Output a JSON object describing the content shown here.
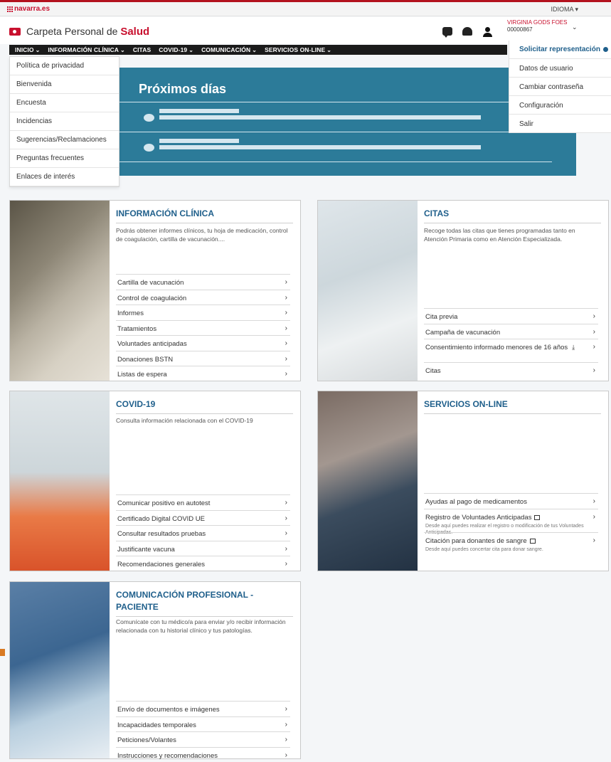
{
  "topbar": {
    "site": "navarra.es",
    "language": "IDIOMA"
  },
  "header": {
    "app_prefix": "Carpeta Personal de",
    "app_highlight": "Salud",
    "user_name": "VIRGINIA GODS FOES",
    "user_id": "00000867",
    "icons": [
      "chat-icon",
      "notification-icon",
      "user-icon"
    ]
  },
  "nav": {
    "items": [
      {
        "label": "INICIO"
      },
      {
        "label": "INFORMACIÓN CLÍNICA"
      },
      {
        "label": "CITAS"
      },
      {
        "label": "COVID-19"
      },
      {
        "label": "COMUNICACIÓN"
      },
      {
        "label": "SERVICIOS ON-LINE"
      }
    ]
  },
  "inicio_menu": [
    "Política de privacidad",
    "Bienvenida",
    "Encuesta",
    "Incidencias",
    "Sugerencias/Reclamaciones",
    "Preguntas frecuentes",
    "Enlaces de interés"
  ],
  "user_menu": {
    "solicitar": "Solicitar representación",
    "items": [
      "Datos de usuario",
      "Cambiar contraseña",
      "Configuración",
      "Salir"
    ]
  },
  "proximos": {
    "title": "Próximos días"
  },
  "cards": {
    "clinica": {
      "title": "INFORMACIÓN CLÍNICA",
      "desc": "Podrás obtener informes clínicos, tu hoja de medicación, control de coagulación, cartilla de vacunación....",
      "links": [
        "Cartilla de vacunación",
        "Control de coagulación",
        "Informes",
        "Tratamientos",
        "Voluntades anticipadas",
        "Donaciones BSTN",
        "Listas de espera"
      ]
    },
    "citas": {
      "title": "CITAS",
      "desc": "Recoge todas las citas que tienes programadas tanto en Atención Primaria como en Atención Especializada.",
      "links": [
        "Cita previa",
        "Campaña de vacunación",
        "Consentimiento informado menores de 16 años",
        "Citas"
      ]
    },
    "covid": {
      "title": "COVID-19",
      "desc": "Consulta información relacionada con el COVID-19",
      "links": [
        "Comunicar positivo en autotest",
        "Certificado Digital COVID UE",
        "Consultar resultados pruebas",
        "Justificante vacuna",
        "Recomendaciones generales"
      ]
    },
    "servicios": {
      "title": "SERVICIOS ON-LINE",
      "links": [
        {
          "label": "Ayudas al pago de medicamentos",
          "sub": ""
        },
        {
          "label": "Registro de Voluntades Anticipadas",
          "sub": "Desde aquí puedes realizar el registro o modificación de tus Voluntades Anticipadas."
        },
        {
          "label": "Citación para donantes de sangre",
          "sub": "Desde aquí puedes concertar cita para donar sangre."
        }
      ]
    },
    "comunicacion": {
      "title": "COMUNICACIÓN PROFESIONAL - PACIENTE",
      "desc": "Comunícate con tu médico/a para enviar y/o recibir información relacionada con tu historial clínico y tus patologías.",
      "links": [
        "Envío de documentos e imágenes",
        "Incapacidades temporales",
        "Peticiones/Volantes",
        "Instrucciones y recomendaciones"
      ]
    }
  }
}
